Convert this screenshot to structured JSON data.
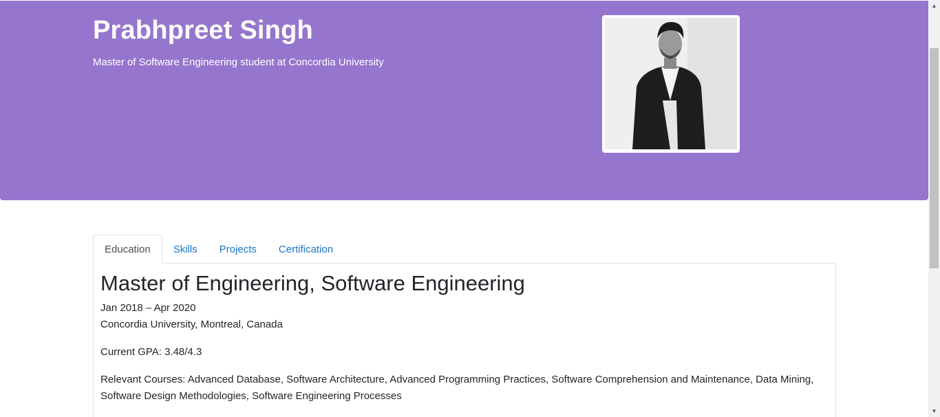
{
  "header": {
    "name": "Prabhpreet Singh",
    "subtitle": "Master of Software Engineering student at Concordia University",
    "background_color": "#9575cd"
  },
  "profile_photo": {
    "alt": "profile photo"
  },
  "tabs": [
    {
      "label": "Education",
      "active": true
    },
    {
      "label": "Skills",
      "active": false
    },
    {
      "label": "Projects",
      "active": false
    },
    {
      "label": "Certification",
      "active": false
    }
  ],
  "education": {
    "degree": "Master of Engineering, Software Engineering",
    "dates": "Jan 2018 – Apr 2020",
    "institution": "Concordia University, Montreal, Canada",
    "gpa": "Current GPA: 3.48/4.3",
    "courses": "Relevant Courses: Advanced Database, Software Architecture, Advanced Programming Practices, Software Comprehension and Maintenance, Data Mining, Software Design Methodologies, Software Engineering Processes"
  },
  "scrollbar": {
    "up_icon": "triangle-up-icon",
    "down_icon": "triangle-down-icon"
  }
}
